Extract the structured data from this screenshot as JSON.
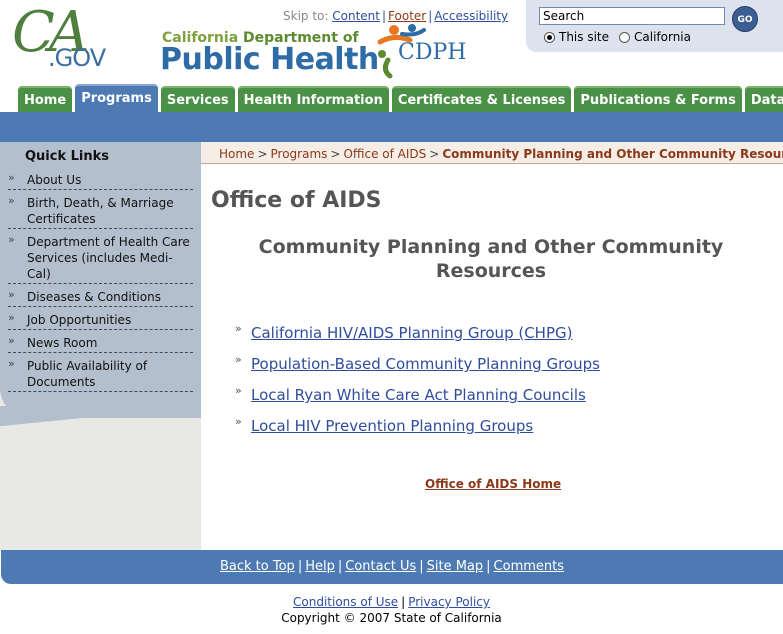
{
  "header": {
    "cagov_big": "CA",
    "cagov_gov": ".GOV",
    "dept_line1_a": "California ",
    "dept_line1_b": "Department of",
    "dept_line2": "Public Health",
    "logo_word": "CDPH",
    "skip_to_label": "Skip to:",
    "skip_links": [
      "Content",
      "Footer",
      "Accessibility"
    ],
    "search": {
      "value": "Search",
      "go_label": "GO",
      "options": [
        "This site",
        "California"
      ],
      "selected": "This site"
    }
  },
  "nav": {
    "tabs": [
      "Home",
      "Programs",
      "Services",
      "Health Information",
      "Certificates & Licenses",
      "Publications & Forms",
      "Data"
    ],
    "active": "Programs"
  },
  "sidebar": {
    "heading": "Quick Links",
    "items": [
      "About Us",
      "Birth, Death, & Marriage Certificates",
      "Department of Health Care Services (includes Medi-Cal)",
      "Diseases & Conditions",
      "Job Opportunities",
      "News Room",
      "Public Availability of Documents"
    ]
  },
  "breadcrumb": {
    "items": [
      "Home",
      "Programs",
      "Office of AIDS"
    ],
    "current": "Community Planning and Other Community Resources"
  },
  "main": {
    "page_title": "Office of AIDS",
    "section_title": "Community Planning and Other Community Resources",
    "links": [
      "California HIV/AIDS Planning Group (CHPG)",
      "Population-Based Community Planning Groups",
      "Local Ryan White Care Act Planning Councils",
      "Local HIV Prevention Planning Groups"
    ],
    "home_link": "Office of AIDS Home"
  },
  "footer": {
    "links": [
      "Back to Top",
      "Help",
      "Contact Us",
      "Site Map",
      "Comments"
    ],
    "bottom_links": [
      "Conditions of Use",
      "Privacy Policy"
    ],
    "copyright": "Copyright © 2007 State of California"
  },
  "colors": {
    "nav_green": "#4a9147",
    "nav_blue": "#4e7ab4",
    "link_blue": "#2f4d9c",
    "link_brown": "#8a3a1a",
    "sidebar": "#b4bfcd"
  }
}
